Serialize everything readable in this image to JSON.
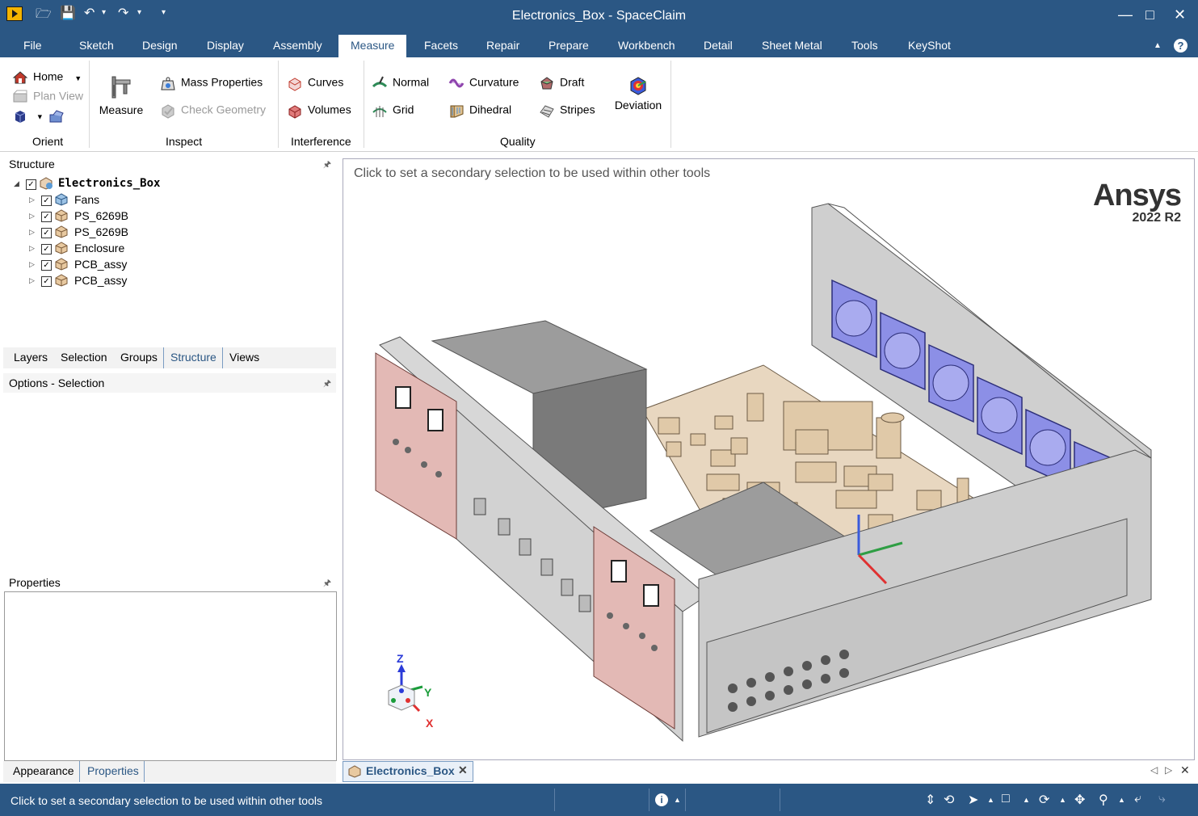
{
  "window": {
    "title": "Electronics_Box - SpaceClaim"
  },
  "menu": [
    "File",
    "Sketch",
    "Design",
    "Display",
    "Assembly",
    "Measure",
    "Facets",
    "Repair",
    "Prepare",
    "Workbench",
    "Detail",
    "Sheet Metal",
    "Tools",
    "KeyShot"
  ],
  "ribbon": {
    "orient": {
      "home": "Home",
      "plan_view": "Plan View",
      "group": "Orient"
    },
    "inspect": {
      "measure": "Measure",
      "mass_properties": "Mass Properties",
      "check_geometry": "Check Geometry",
      "group": "Inspect"
    },
    "interference": {
      "curves": "Curves",
      "volumes": "Volumes",
      "group": "Interference"
    },
    "quality": {
      "normal": "Normal",
      "grid": "Grid",
      "curvature": "Curvature",
      "dihedral": "Dihedral",
      "draft": "Draft",
      "stripes": "Stripes",
      "deviation": "Deviation",
      "group": "Quality"
    }
  },
  "structure": {
    "title": "Structure",
    "root": "Electronics_Box",
    "items": [
      "Fans",
      "PS_6269B",
      "PS_6269B",
      "Enclosure",
      "PCB_assy",
      "PCB_assy"
    ]
  },
  "panel_tabs": [
    "Layers",
    "Selection",
    "Groups",
    "Structure",
    "Views"
  ],
  "options_title": "Options - Selection",
  "properties_title": "Properties",
  "bottom_tabs": [
    "Appearance",
    "Properties"
  ],
  "viewport": {
    "hint": "Click to set a secondary selection to be used within other tools",
    "brand": "Ansys",
    "version": "2022 R2",
    "axes": {
      "z": "Z",
      "y": "Y",
      "x": "X"
    }
  },
  "doc_tab": "Electronics_Box",
  "status": {
    "text": "Click to set a secondary selection to be used within other tools"
  },
  "colors": {
    "chrome": "#2b5784",
    "panel_pink": "#e3b9b5",
    "pcb": "#e8d7c0",
    "fan": "#8c8fe6",
    "metal": "#c8c8c8"
  }
}
